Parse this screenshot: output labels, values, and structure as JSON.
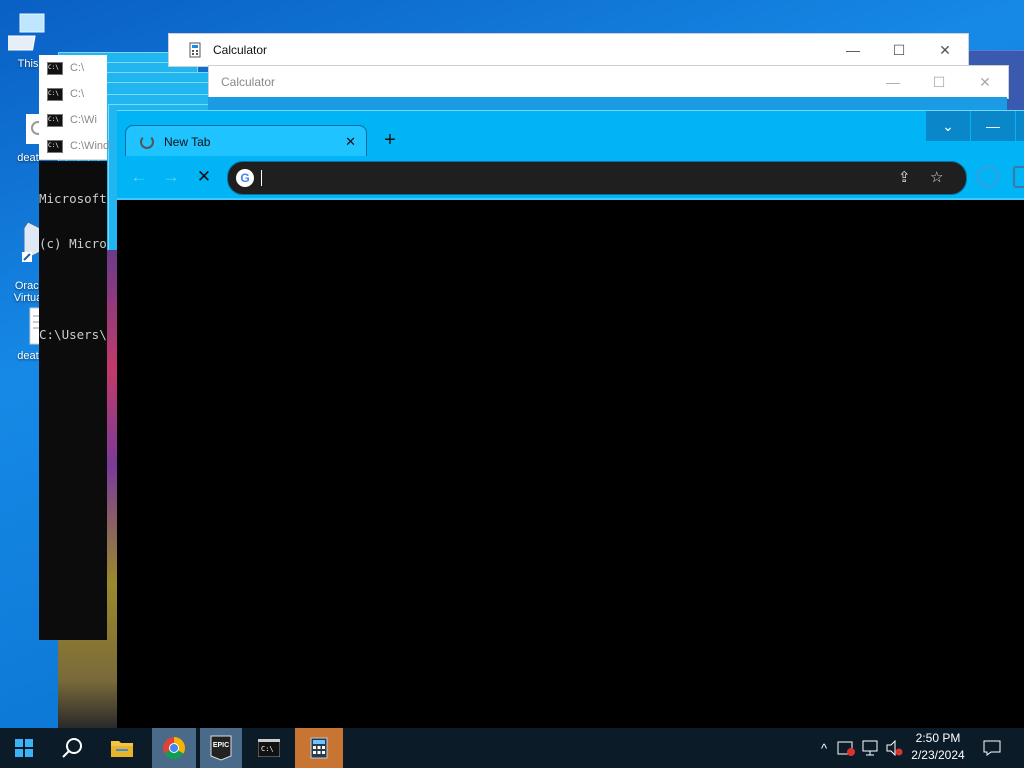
{
  "desktop": {
    "icons": [
      {
        "label": "This"
      },
      {
        "label": "deat"
      },
      {
        "label": "Oracl\nVirtua"
      },
      {
        "label": "deat"
      }
    ]
  },
  "cmd": {
    "windows": [
      {
        "title": "C:\\"
      },
      {
        "title": "C:\\Wi"
      },
      {
        "title": "C:\\Wind"
      }
    ],
    "lines": [
      "Microsoft",
      "(c) Micro",
      "",
      "C:\\Users\\"
    ]
  },
  "calculator": {
    "back": {
      "title": "Calculator"
    },
    "front": {
      "title": "Calculator"
    }
  },
  "chrome": {
    "tab": {
      "label": "New Tab",
      "close": "✕"
    },
    "new_tab": "+",
    "window_controls": {
      "list": "⌄",
      "minimize": "—"
    },
    "omnibox": {
      "value": "",
      "placeholder": ""
    }
  },
  "taskbar": {
    "apps": [
      "Start",
      "Search",
      "File Explorer",
      "Google Chrome",
      "Epic Games Launcher",
      "Command Prompt",
      "Calculator"
    ],
    "clock": {
      "time": "2:50 PM",
      "date": "2/23/2024"
    }
  },
  "colors": {
    "chrome_frame": "#00b4f5",
    "taskbar": "#0c1b28",
    "calc_taskbar": "#c87432"
  }
}
